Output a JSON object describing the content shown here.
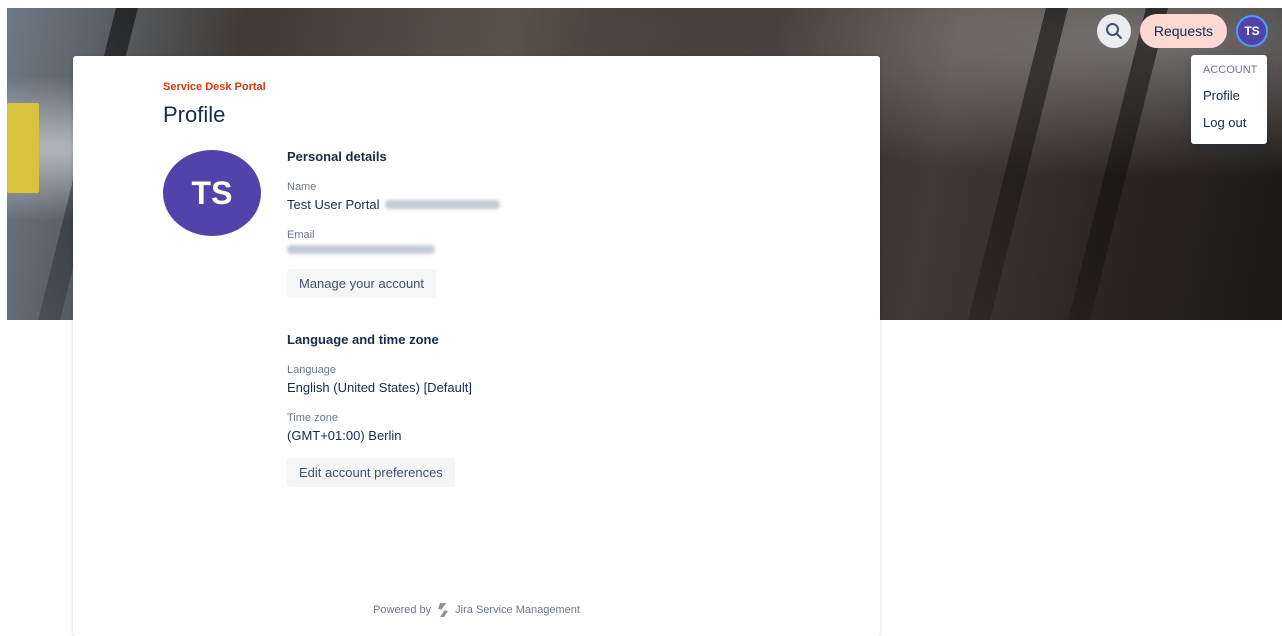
{
  "header": {
    "requests_label": "Requests",
    "avatar_initials": "TS",
    "search_icon": "search-icon"
  },
  "account_menu": {
    "heading": "ACCOUNT",
    "items": [
      "Profile",
      "Log out"
    ]
  },
  "breadcrumb": "Service Desk Portal",
  "page_title": "Profile",
  "profile": {
    "avatar_initials": "TS",
    "personal_details": {
      "title": "Personal details",
      "name_label": "Name",
      "name_value": "Test User Portal",
      "email_label": "Email",
      "manage_button": "Manage your account"
    },
    "language_section": {
      "title": "Language and time zone",
      "language_label": "Language",
      "language_value": "English (United States) [Default]",
      "timezone_label": "Time zone",
      "timezone_value": "(GMT+01:00) Berlin",
      "edit_button": "Edit account preferences"
    }
  },
  "footer": {
    "powered_by": "Powered by",
    "product": "Jira Service Management",
    "logo_icon": "jira-logo-icon"
  },
  "colors": {
    "accent": "#de350b",
    "avatar": "#5243aa",
    "requests_bg": "#fdd9d3"
  }
}
